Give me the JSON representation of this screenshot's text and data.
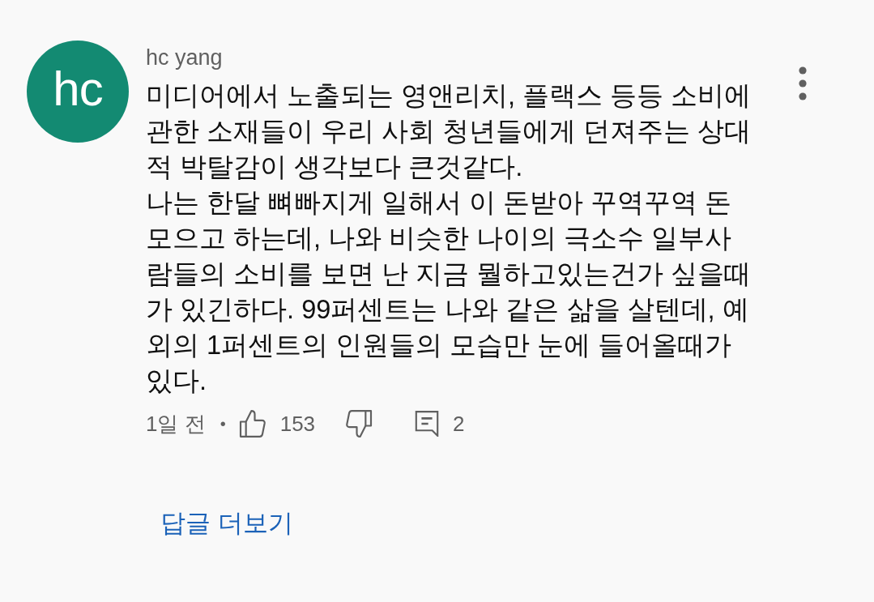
{
  "comment": {
    "avatar_initials": "hc",
    "author": "hc yang",
    "text": "미디어에서 노출되는 영앤리치, 플랙스 등등 소비에 관한 소재들이 우리 사회 청년들에게 던져주는 상대적 박탈감이 생각보다 큰것같다.\n나는 한달 뼈빠지게 일해서 이 돈받아 꾸역꾸역 돈 모으고 하는데, 나와 비슷한 나이의 극소수 일부사람들의 소비를 보면 난 지금 뭘하고있는건가 싶을때가 있긴하다. 99퍼센트는 나와 같은 삶을 살텐데, 예외의 1퍼센트의 인원들의 모습만 눈에 들어올때가 있다.",
    "time": "1일 전",
    "separator": "•",
    "likes": "153",
    "replies": "2"
  },
  "more_replies": "답글 더보기"
}
